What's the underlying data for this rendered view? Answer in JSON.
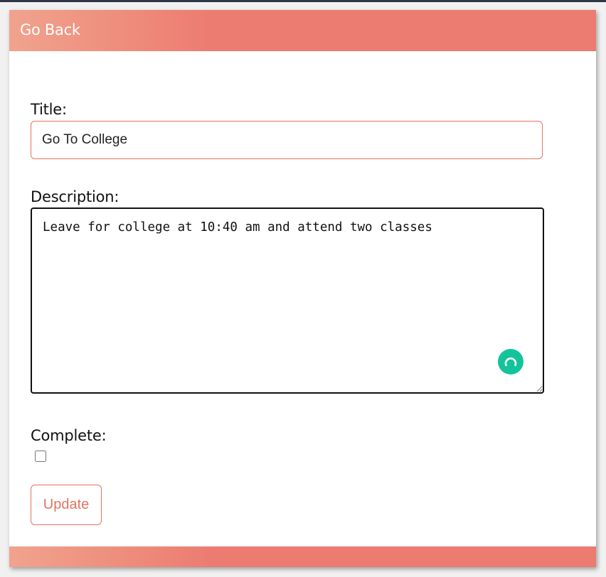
{
  "header": {
    "go_back_label": "Go Back"
  },
  "form": {
    "title_label": "Title:",
    "title_value": "Go To College",
    "description_label": "Description:",
    "description_value": "Leave for college at 10:40 am and attend two classes",
    "complete_label": "Complete:",
    "complete_checked": false,
    "update_label": "Update"
  },
  "colors": {
    "accent": "#ec7b71",
    "accent_light": "#f0a38e",
    "button_text": "#e2745f",
    "grammarly": "#15c39a"
  },
  "icons": {
    "grammarly": "grammarly-icon"
  }
}
